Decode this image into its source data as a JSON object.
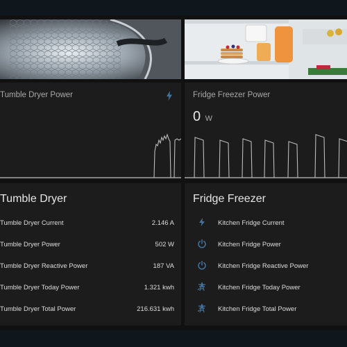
{
  "colors": {
    "accent": "#44739e",
    "card_bg": "#1c1c1c",
    "chart_line": "#bdbdbd"
  },
  "dryer": {
    "power_title": "Tumble Dryer Power",
    "entities_title": "Tumble Dryer",
    "rows": [
      {
        "name": "Tumble Dryer Current",
        "value": "2.146 A"
      },
      {
        "name": "Tumble Dryer Power",
        "value": "502 W"
      },
      {
        "name": "Tumble Dryer Reactive Power",
        "value": "187 VA"
      },
      {
        "name": "Tumble Dryer Today Power",
        "value": "1.321 kwh"
      },
      {
        "name": "Tumble Dryer Total Power",
        "value": "216.631 kwh"
      }
    ]
  },
  "fridge": {
    "power_title": "Fridge Freezer Power",
    "power_value": "0",
    "power_unit": "W",
    "entities_title": "Fridge Freezer",
    "rows": [
      {
        "name": "Kitchen Fridge Current",
        "icon": "flash-icon"
      },
      {
        "name": "Kitchen Fridge Power",
        "icon": "power-icon"
      },
      {
        "name": "Kitchen Fridge Reactive Power",
        "icon": "power-icon"
      },
      {
        "name": "Kitchen Fridge Today Power",
        "icon": "transmission-tower-icon"
      },
      {
        "name": "Kitchen Fridge Total Power",
        "icon": "transmission-tower-icon"
      }
    ]
  }
}
